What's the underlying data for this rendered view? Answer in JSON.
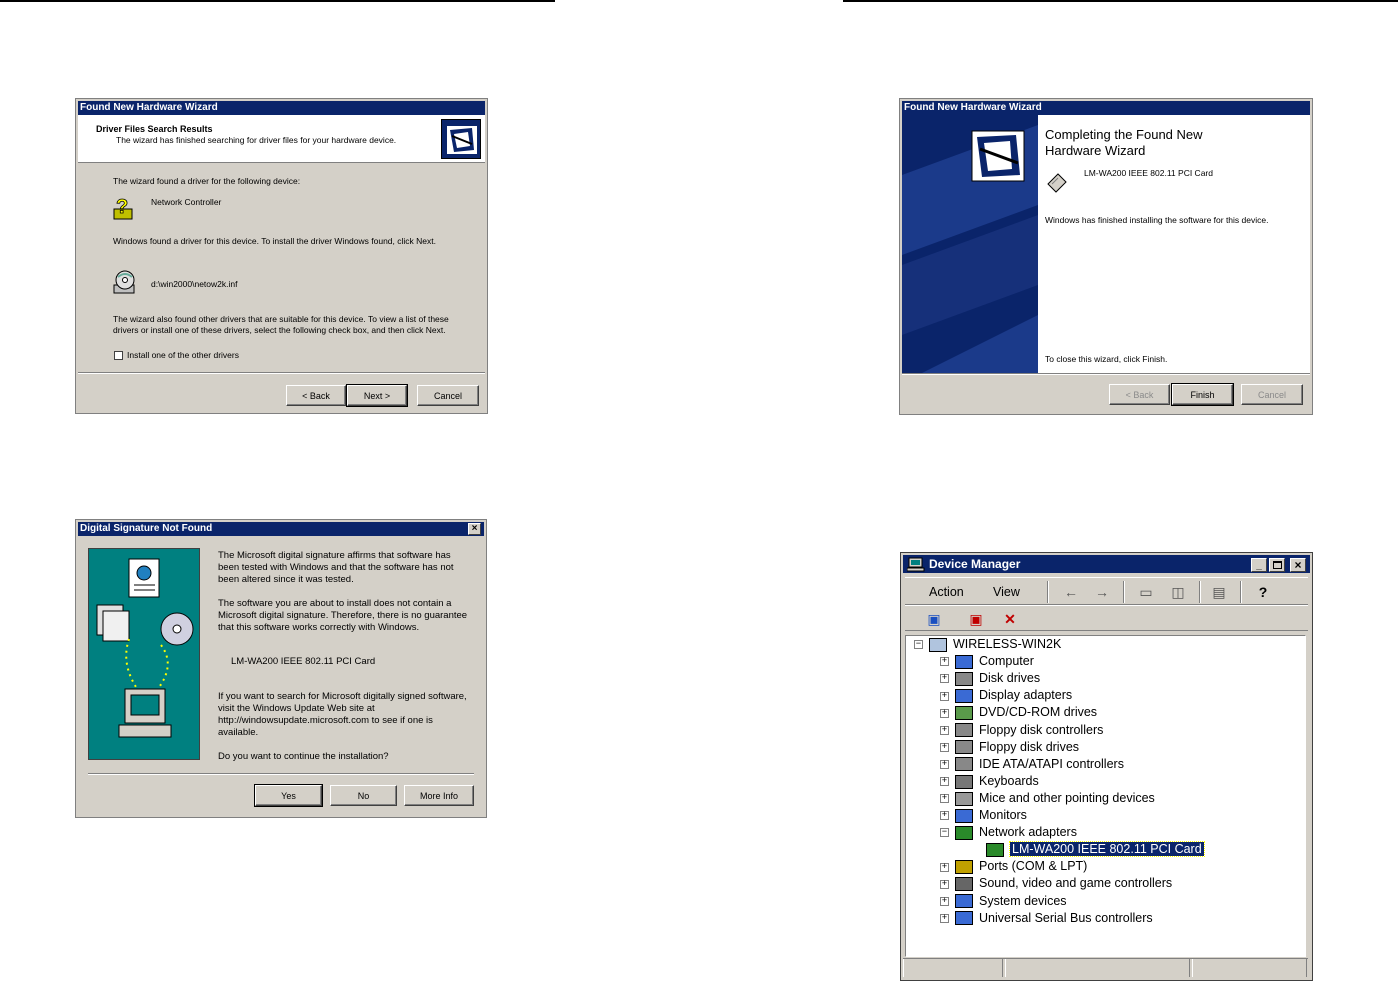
{
  "wizard1": {
    "title": "Found New Hardware Wizard",
    "header_title": "Driver Files Search Results",
    "header_subtitle": "The wizard has finished searching for driver files for your hardware device.",
    "found_text": "The wizard found a driver for the following device:",
    "device_name": "Network Controller",
    "found_driver_text": "Windows found a driver for this device. To install the driver Windows found, click Next.",
    "driver_path": "d:\\win2000\\netow2k.inf",
    "other_drivers_text": "The wizard also found other drivers that are suitable for this device. To view a list of these drivers or install one of these drivers, select the following check box, and then click Next.",
    "checkbox_label": "Install one of the other drivers",
    "back_label": "< Back",
    "next_label": "Next >",
    "cancel_label": "Cancel"
  },
  "wizard2": {
    "title": "Found New Hardware Wizard",
    "heading_line1": "Completing the Found New",
    "heading_line2": "Hardware Wizard",
    "device_name": "LM-WA200 IEEE 802.11 PCI Card",
    "finished_text": "Windows has finished installing the software for this device.",
    "close_text": "To close this wizard, click Finish.",
    "back_label": "< Back",
    "finish_label": "Finish",
    "cancel_label": "Cancel"
  },
  "signature": {
    "title": "Digital Signature Not Found",
    "para1": "The Microsoft digital signature affirms that software has been tested with Windows and that the software has not been altered since it was tested.",
    "para2": "The software you are about to install does not contain a Microsoft digital signature. Therefore,  there is no guarantee that this software works correctly with Windows.",
    "device_name": "LM-WA200 IEEE 802.11 PCI Card",
    "para3": "If you want to search for Microsoft digitally signed software, visit the Windows Update Web site at http://windowsupdate.microsoft.com to see if one is available.",
    "question": "Do you want to continue the installation?",
    "yes_label": "Yes",
    "no_label": "No",
    "more_info_label": "More Info"
  },
  "device_manager": {
    "title": "Device Manager",
    "menu_action": "Action",
    "menu_view": "View",
    "root": "WIRELESS-WIN2K",
    "items": [
      "Computer",
      "Disk drives",
      "Display adapters",
      "DVD/CD-ROM drives",
      "Floppy disk controllers",
      "Floppy disk drives",
      "IDE ATA/ATAPI controllers",
      "Keyboards",
      "Mice and other pointing devices",
      "Monitors",
      "Network adapters"
    ],
    "network_child": "LM-WA200 IEEE 802.11 PCI Card",
    "items_after": [
      "Ports (COM & LPT)",
      "Sound, video and game controllers",
      "System devices",
      "Universal Serial Bus controllers"
    ]
  },
  "colors": {
    "titlebar": "#0a246a",
    "dialog_face": "#d4d0c8",
    "signature_panel": "#008080",
    "selection": "#0a246a"
  }
}
